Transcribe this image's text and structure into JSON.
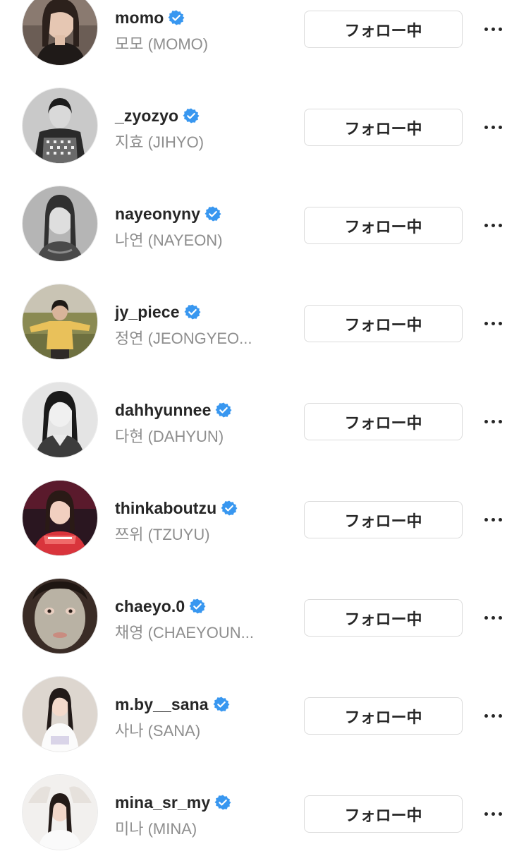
{
  "accounts": [
    {
      "username": "momo",
      "fullname": "모모 (MOMO)",
      "verified": true,
      "button": "フォロー中",
      "avatar": "avatar-photo"
    },
    {
      "username": "_zyozyo",
      "fullname": "지효 (JIHYO)",
      "verified": true,
      "button": "フォロー中",
      "avatar": "avatar-photo"
    },
    {
      "username": "nayeonyny",
      "fullname": "나연 (NAYEON)",
      "verified": true,
      "button": "フォロー中",
      "avatar": "avatar-photo"
    },
    {
      "username": "jy_piece",
      "fullname": "정연 (JEONGYEO...",
      "verified": true,
      "button": "フォロー中",
      "avatar": "avatar-photo"
    },
    {
      "username": "dahhyunnee",
      "fullname": "다현 (DAHYUN)",
      "verified": true,
      "button": "フォロー中",
      "avatar": "avatar-photo"
    },
    {
      "username": "thinkaboutzu",
      "fullname": "쯔위 (TZUYU)",
      "verified": true,
      "button": "フォロー中",
      "avatar": "avatar-photo"
    },
    {
      "username": "chaeyo.0",
      "fullname": "채영 (CHAEYOUN...",
      "verified": true,
      "button": "フォロー中",
      "avatar": "avatar-photo"
    },
    {
      "username": "m.by__sana",
      "fullname": "사나 (SANA)",
      "verified": true,
      "button": "フォロー中",
      "avatar": "avatar-photo"
    },
    {
      "username": "mina_sr_my",
      "fullname": "미나 (MINA)",
      "verified": true,
      "button": "フォロー中",
      "avatar": "avatar-photo"
    }
  ],
  "icons": {
    "verified": "verified-badge-icon",
    "more": "more-horizontal-icon"
  },
  "colors": {
    "verified_blue": "#3897f0",
    "text_primary": "#262626",
    "text_secondary": "#8e8e8e",
    "button_border": "#dbdbdb"
  }
}
